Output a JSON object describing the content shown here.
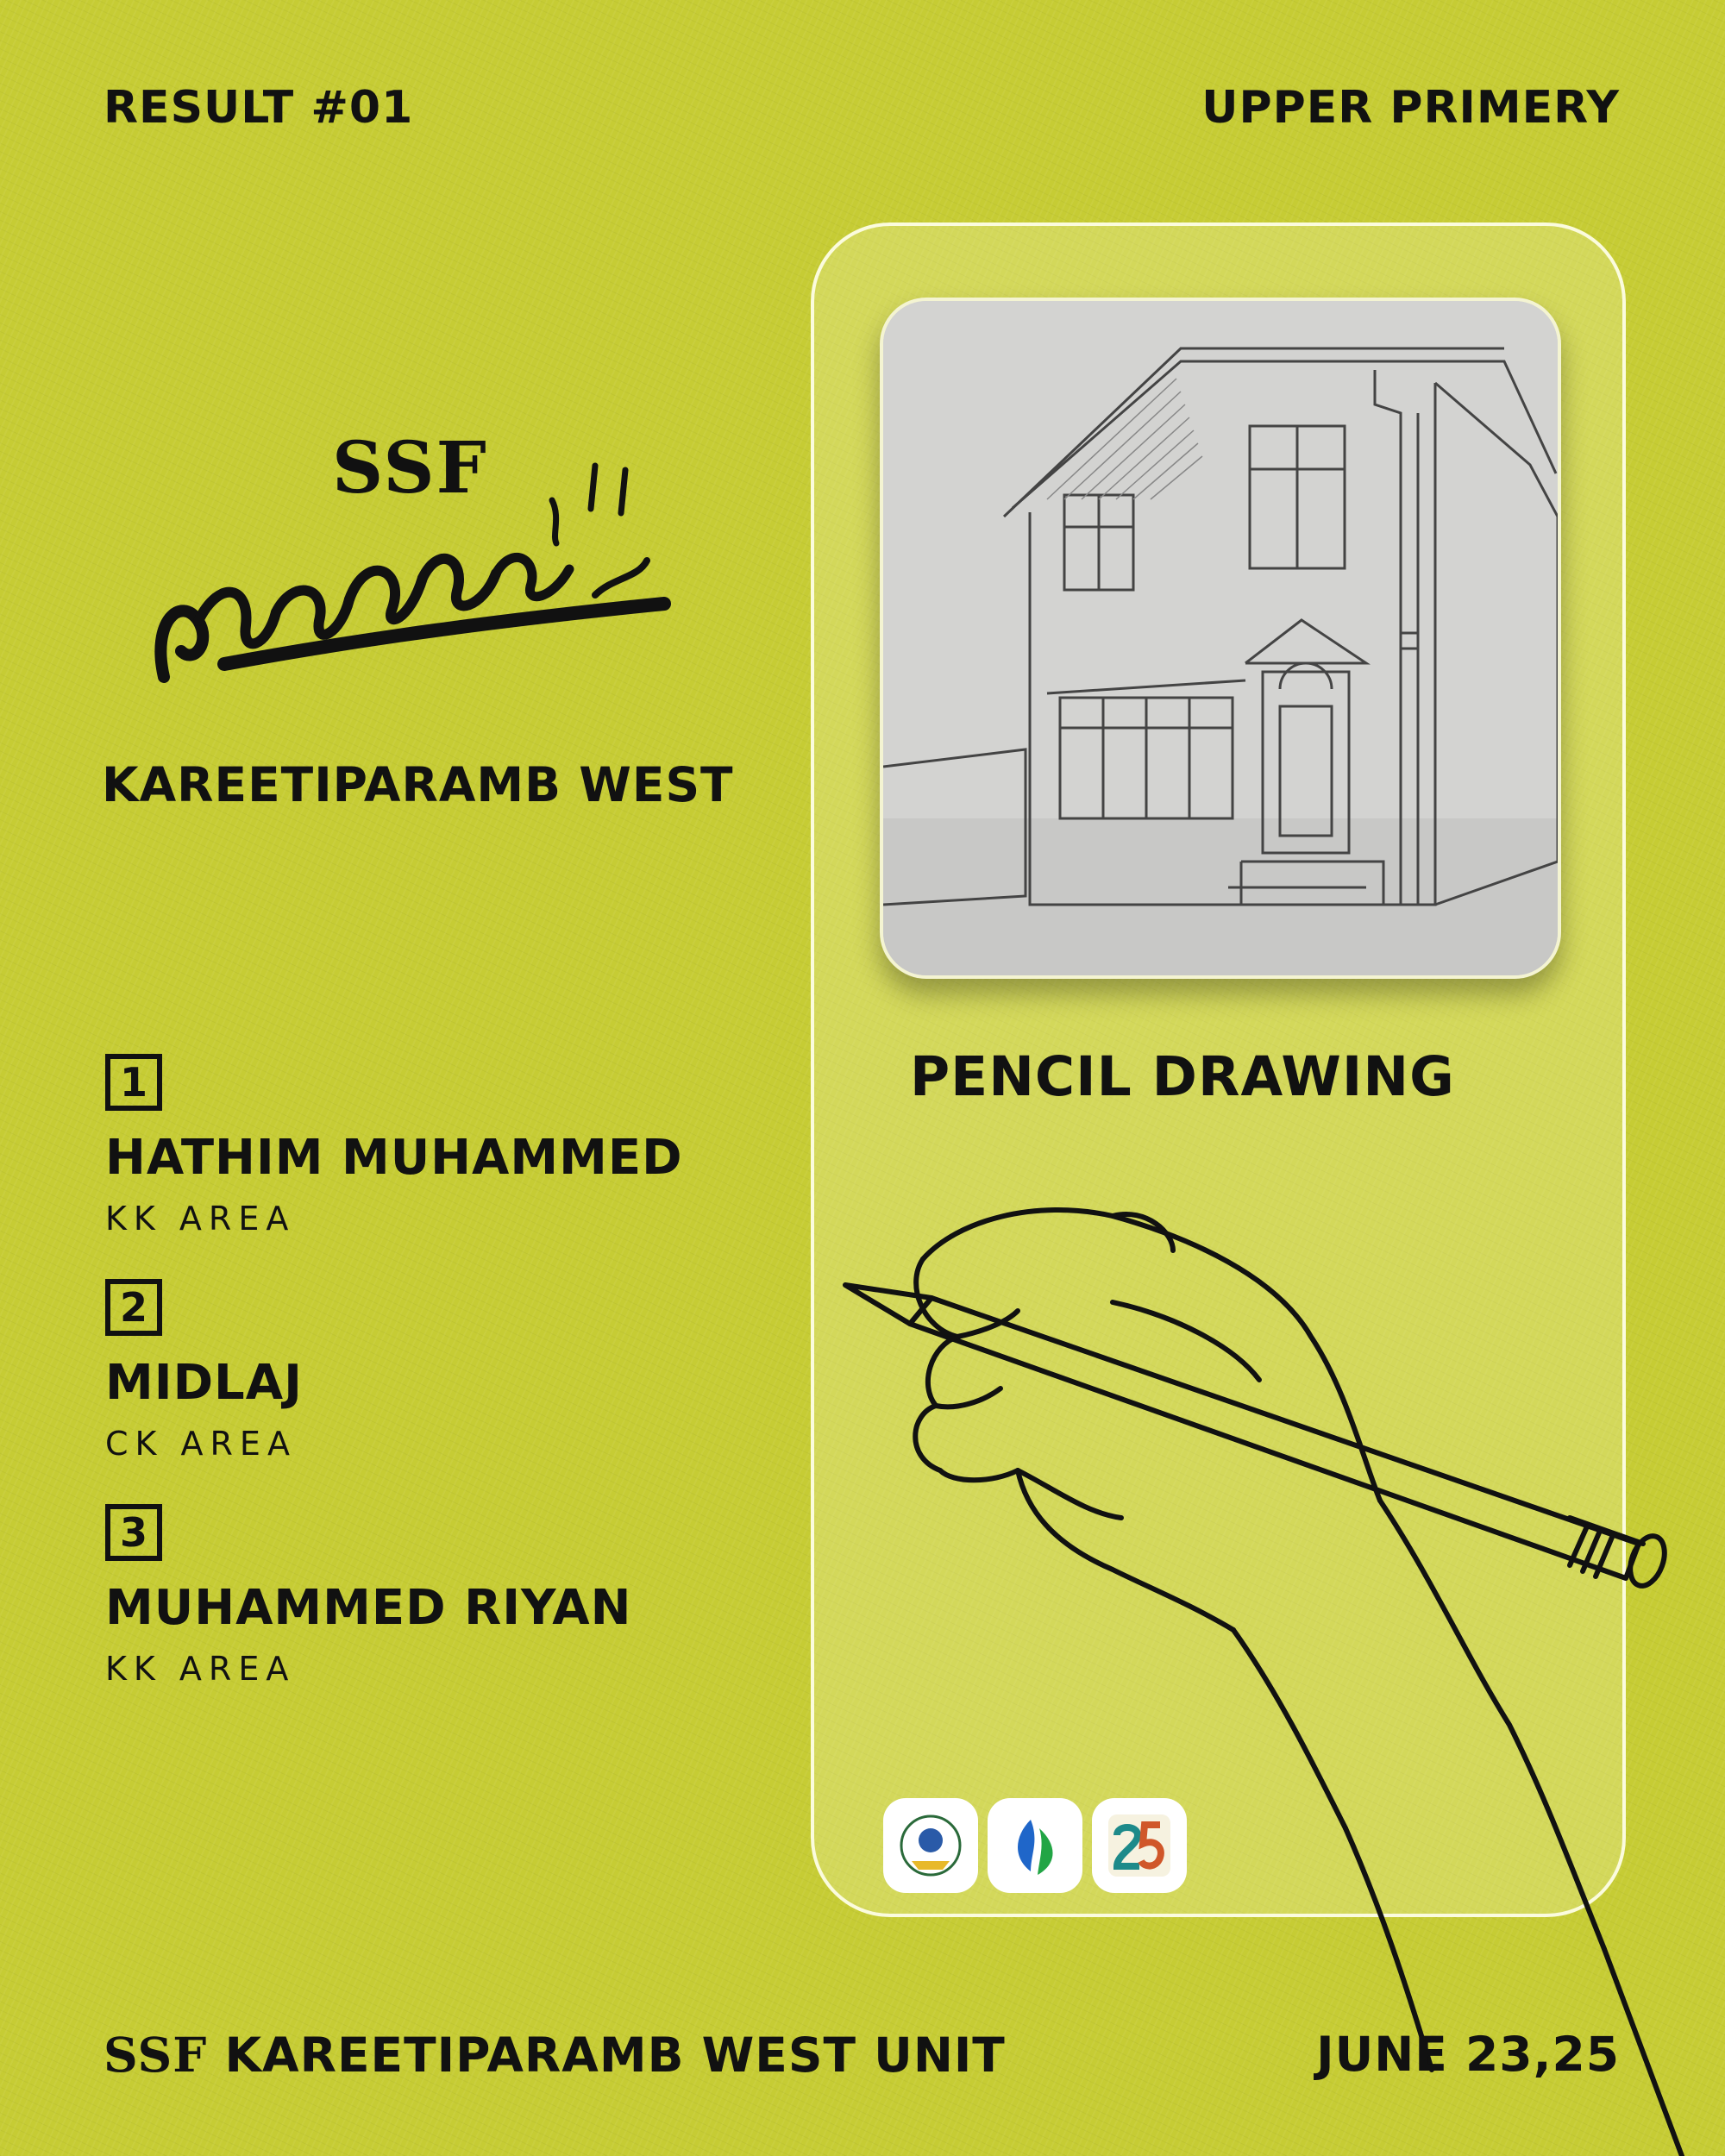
{
  "header": {
    "result_label": "RESULT #01",
    "category": "UPPER PRIMERY"
  },
  "branding": {
    "org_logo_text": "SSF",
    "unit_name": "KAREETIPARAMB WEST"
  },
  "event": {
    "title": "PENCIL DRAWING"
  },
  "winners": [
    {
      "rank": "1",
      "name": "HATHIM MUHAMMED",
      "area": "KK AREA"
    },
    {
      "rank": "2",
      "name": "MIDLAJ",
      "area": "CK AREA"
    },
    {
      "rank": "3",
      "name": "MUHAMMED RIYAN",
      "area": "KK AREA"
    }
  ],
  "footer": {
    "org": "SSF",
    "unit": "KAREETIPARAMB WEST UNIT",
    "date": "JUNE 23,25"
  },
  "colors": {
    "background": "#c6cc34",
    "text": "#111111",
    "card_border": "#f4f4d2"
  },
  "icons": [
    "house-pencil-sketch",
    "hand-holding-pencil-icon",
    "organization-emblem-icon",
    "drop-leaf-icon",
    "number-25-icon"
  ]
}
